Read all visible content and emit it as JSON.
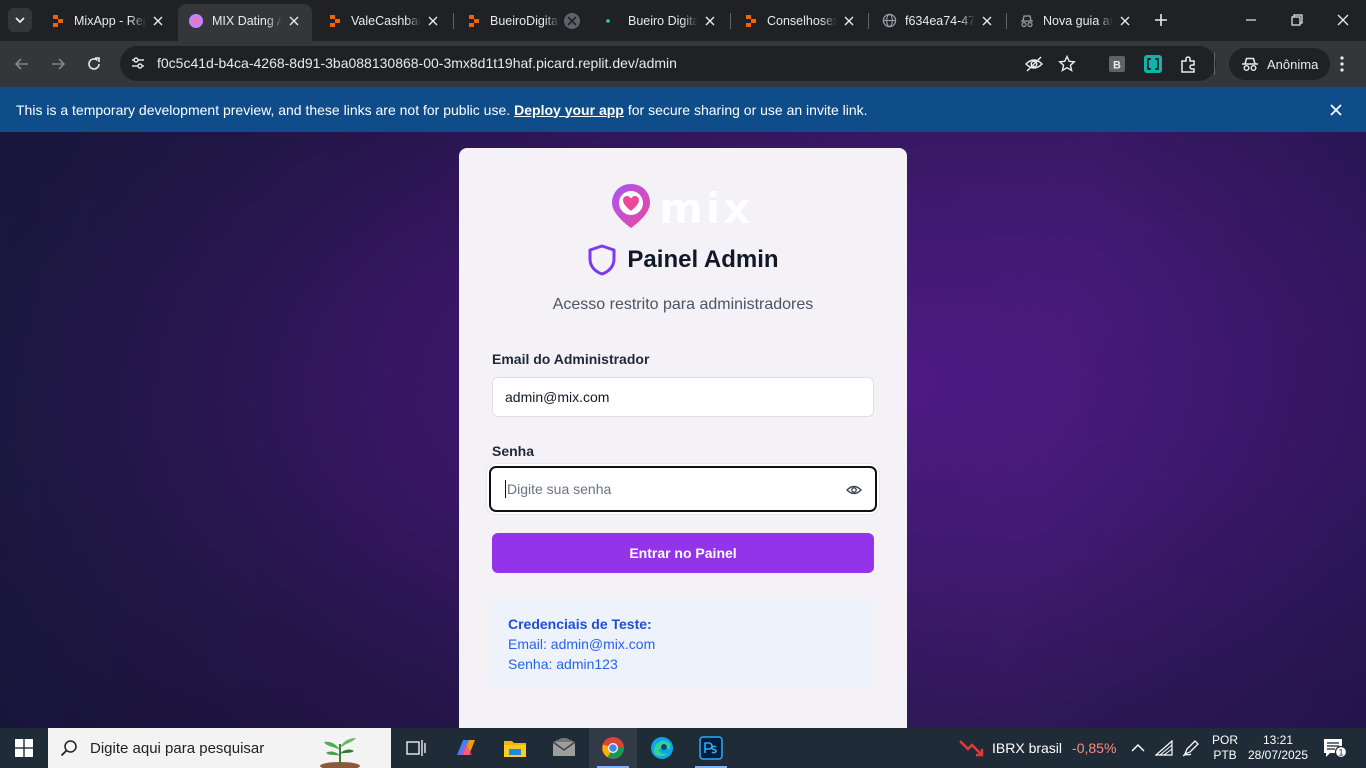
{
  "browser": {
    "tabs": [
      {
        "title": "MixApp - Replit",
        "favicon": "replit-icon"
      },
      {
        "title": "MIX Dating Admin",
        "favicon": "mix-pin-icon"
      },
      {
        "title": "ValeCashback",
        "favicon": "replit-icon"
      },
      {
        "title": "BueiroDigital",
        "favicon": "replit-icon"
      },
      {
        "title": "Bueiro Digital",
        "favicon": "dot-icon"
      },
      {
        "title": "Conselhosex",
        "favicon": "replit-icon"
      },
      {
        "title": "f634ea74-47",
        "favicon": "globe-icon"
      },
      {
        "title": "Nova guia anônima",
        "favicon": "incognito-icon"
      }
    ],
    "url": "f0c5c41d-b4ca-4268-8d91-3ba088130868-00-3mx8d1t19haf.picard.replit.dev/admin",
    "incognito_label": "Anônima",
    "extensions": [
      "B"
    ]
  },
  "banner": {
    "text_before": "This is a temporary development preview, and these links are not for public use.",
    "link": "Deploy your app",
    "text_after": "for secure sharing or use an invite link."
  },
  "login": {
    "logo_text": "mix",
    "title": "Painel Admin",
    "subtitle": "Acesso restrito para administradores",
    "email_label": "Email do Administrador",
    "email_value": "admin@mix.com",
    "password_label": "Senha",
    "password_placeholder": "Digite sua senha",
    "submit_label": "Entrar no Painel",
    "credentials": {
      "heading": "Credenciais de Teste:",
      "email_line": "Email: admin@mix.com",
      "password_line": "Senha: admin123"
    }
  },
  "taskbar": {
    "search_placeholder": "Digite aqui para pesquisar",
    "stock_name": "IBRX brasil",
    "stock_change": "-0,85%",
    "lang_top": "POR",
    "lang_bottom": "PTB",
    "time": "13:21",
    "date": "28/07/2025",
    "notification_count": "1"
  },
  "colors": {
    "accent": "#9333ea",
    "banner": "#0f4d8a",
    "credentials_text": "#2563eb"
  }
}
